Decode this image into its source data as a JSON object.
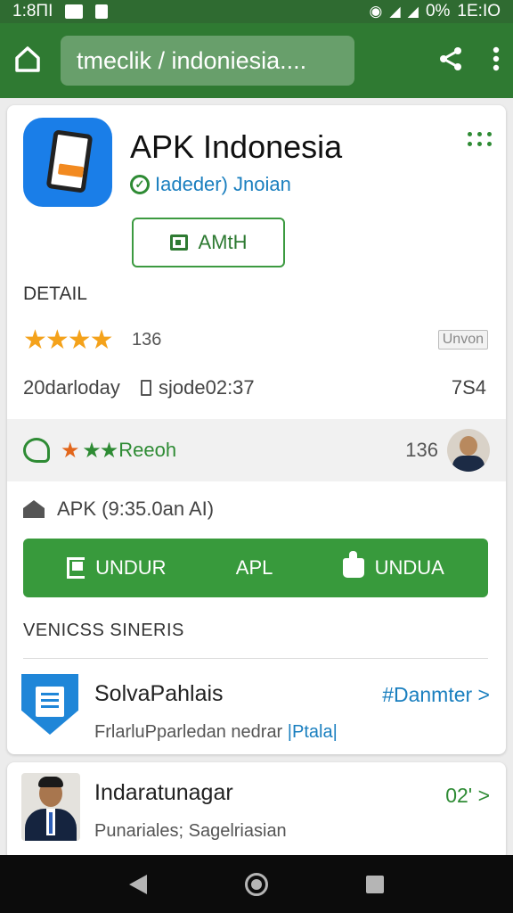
{
  "status_bar": {
    "time_left": "1:8ΠΙ",
    "battery": "0%",
    "time_right": "1Ε:ΙΟ"
  },
  "browser": {
    "url": "tmeclik / indoniesia....",
    "home_icon": "home-icon",
    "share_icon": "share-icon",
    "menu_icon": "more-vert-icon"
  },
  "app": {
    "title": "APK Indonesia",
    "developer": "Iadeder) Jnoian",
    "install_label": "AMtH",
    "detail_label": "DETAIL",
    "rating_count": "136",
    "version_badge": "Unvon",
    "date": "20darloday",
    "code": "sjode02:37",
    "size": "7S4",
    "review_text": "Reeoh",
    "review_count": "136",
    "apk_info": "APK (9:35.0an AI)"
  },
  "download_bar": [
    "UNDUR",
    "APL",
    "UNDUA"
  ],
  "section": {
    "title": "VENICSS SINERIS",
    "items": [
      {
        "title": "SolvaPahlais",
        "subtitle": "FrlarluPparledan nedrar",
        "subtitle_link": "|Ptala|",
        "action": "#Danmter >"
      },
      {
        "title": "Indaratunagar",
        "subtitle": "Punariales; Sagelriasian",
        "action": "02' >"
      }
    ]
  },
  "colors": {
    "primary": "#2f7a32",
    "button": "#389a3c",
    "link": "#1a7fbf",
    "star": "#f4a21b"
  }
}
